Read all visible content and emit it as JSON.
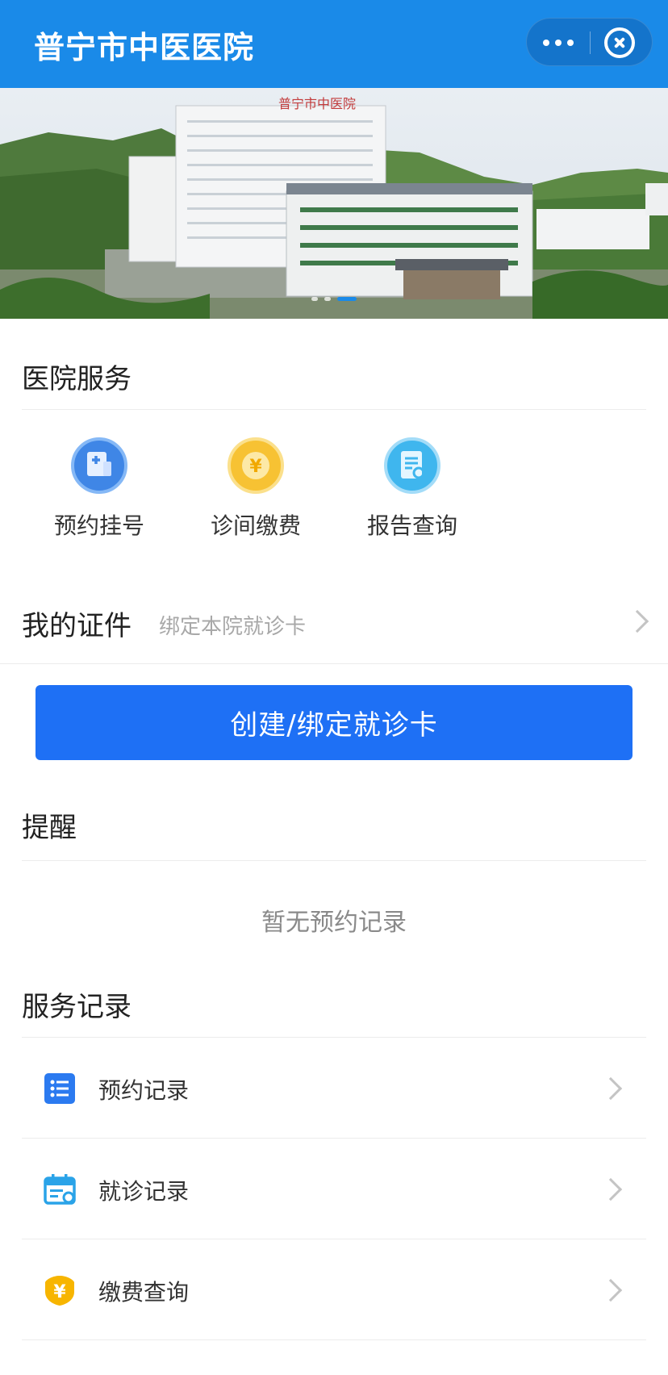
{
  "header": {
    "title": "普宁市中医医院",
    "more_icon": "more-dots-icon",
    "close_icon": "close-circle-icon"
  },
  "banner": {
    "sign_text": "普宁市中医院",
    "active_slide": 3,
    "slide_count": 3
  },
  "hospital_services": {
    "title": "医院服务",
    "items": [
      {
        "label": "预约挂号",
        "icon": "register-icon",
        "color": "#3f86e6"
      },
      {
        "label": "诊间缴费",
        "icon": "yuan-icon",
        "color": "#f7c233"
      },
      {
        "label": "报告查询",
        "icon": "report-icon",
        "color": "#3fb6ee"
      }
    ]
  },
  "my_certificates": {
    "title": "我的证件",
    "hint": "绑定本院就诊卡"
  },
  "bind_button": {
    "label": "创建/绑定就诊卡",
    "color": "#1e70f5"
  },
  "reminder": {
    "title": "提醒",
    "empty_text": "暂无预约记录"
  },
  "service_records": {
    "title": "服务记录",
    "items": [
      {
        "label": "预约记录",
        "icon": "list-icon"
      },
      {
        "label": "就诊记录",
        "icon": "calendar-icon"
      },
      {
        "label": "缴费查询",
        "icon": "yuan-shield-icon"
      }
    ]
  },
  "colors": {
    "header_bg": "#1a8ae8",
    "accent": "#1e70f5"
  }
}
